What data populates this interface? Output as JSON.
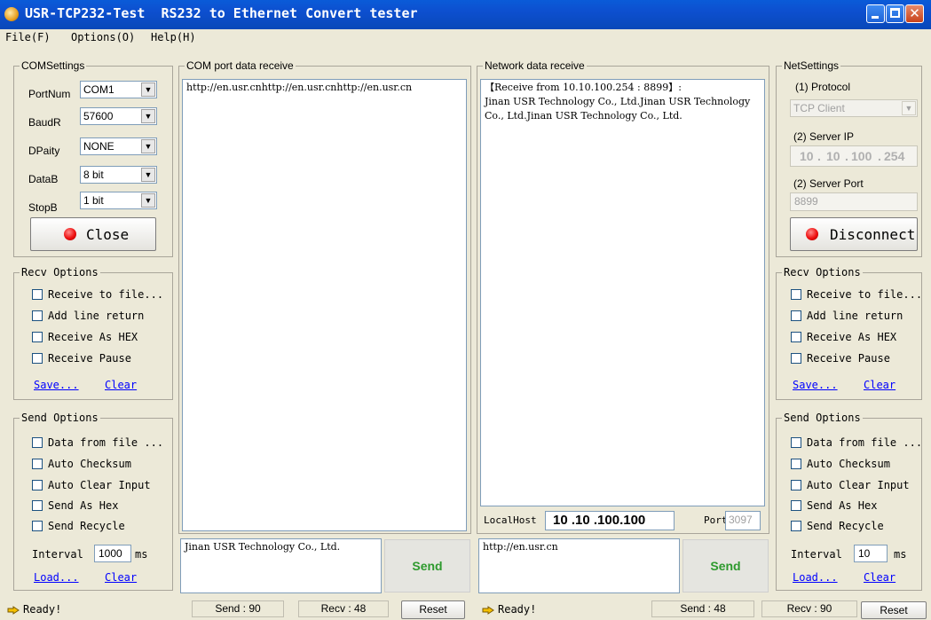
{
  "window": {
    "title": "USR-TCP232-Test  RS232 to Ethernet Convert tester",
    "buttons": [
      "minimize-icon",
      "maximize-icon",
      "close-icon"
    ]
  },
  "menu": {
    "items": [
      "File(F)",
      "Options(O)",
      "Help(H)"
    ]
  },
  "com_settings": {
    "title": "COMSettings",
    "fields": [
      {
        "label": "PortNum",
        "value": "COM1"
      },
      {
        "label": "BaudR",
        "value": "57600"
      },
      {
        "label": "DPaity",
        "value": "NONE"
      },
      {
        "label": "DataB",
        "value": "8 bit"
      },
      {
        "label": "StopB",
        "value": "1 bit"
      }
    ],
    "button_label": "Close"
  },
  "com_recv_options": {
    "title": "Recv Options",
    "checkboxes": [
      "Receive to file...",
      "Add line return",
      "Receive As HEX",
      "Receive Pause"
    ],
    "save_link": "Save...",
    "clear_link": "Clear"
  },
  "com_send_options": {
    "title": "Send Options",
    "checkboxes": [
      "Data from file ...",
      "Auto Checksum",
      "Auto Clear Input",
      "Send As Hex",
      "Send Recycle"
    ],
    "interval_label": "Interval",
    "interval_value": "1000",
    "interval_unit": "ms",
    "load_link": "Load...",
    "clear_link": "Clear"
  },
  "com_receive_panel": {
    "title": "COM port data receive",
    "content": "http://en.usr.cnhttp://en.usr.cnhttp://en.usr.cn"
  },
  "com_send_input": {
    "value": "Jinan USR Technology Co., Ltd.",
    "send_label": "Send"
  },
  "network_receive_panel": {
    "title": "Network data receive",
    "content": "【Receive from 10.10.100.254 : 8899】:\nJinan USR Technology Co., Ltd.Jinan USR Technology Co., Ltd.Jinan USR Technology Co., Ltd."
  },
  "local_host": {
    "label": "LocalHost",
    "value": "10 .10 .100.100",
    "port_label": "Port",
    "port_value": "3097"
  },
  "net_send_input": {
    "value": "http://en.usr.cn",
    "send_label": "Send"
  },
  "net_settings": {
    "title": "NetSettings",
    "protocol_label": "(1) Protocol",
    "protocol_value": "TCP Client",
    "server_ip_label": "(2) Server IP",
    "server_ip_octets": [
      "10",
      "10",
      "100",
      "254"
    ],
    "server_port_label": "(2) Server Port",
    "server_port_value": "8899",
    "button_label": "Disconnect"
  },
  "net_recv_options": {
    "title": "Recv Options",
    "checkboxes": [
      "Receive to file...",
      "Add line return",
      "Receive As HEX",
      "Receive Pause"
    ],
    "save_link": "Save...",
    "clear_link": "Clear"
  },
  "net_send_options": {
    "title": "Send Options",
    "checkboxes": [
      "Data from file ...",
      "Auto Checksum",
      "Auto Clear Input",
      "Send As Hex",
      "Send Recycle"
    ],
    "interval_label": "Interval",
    "interval_value": "10",
    "interval_unit": "ms",
    "load_link": "Load...",
    "clear_link": "Clear"
  },
  "status_bar": {
    "left_ready": "Ready!",
    "com_send": "Send : 90",
    "com_recv": "Recv : 48",
    "com_reset": "Reset",
    "right_ready": "Ready!",
    "net_send": "Send : 48",
    "net_recv": "Recv : 90",
    "net_reset": "Reset"
  },
  "colors": {
    "titlebar": "#0a5bd8",
    "window_bg": "#ece9d8",
    "send_text": "#2e9a2e",
    "link": "#0000ff",
    "led": "#ee1010"
  }
}
